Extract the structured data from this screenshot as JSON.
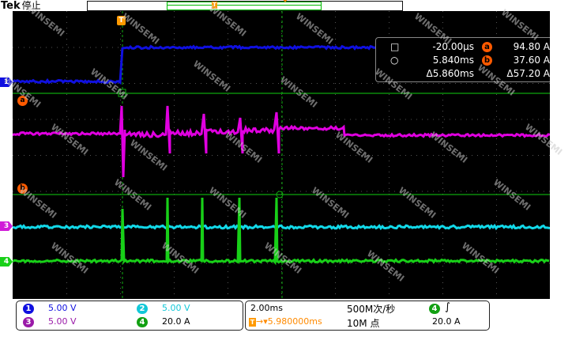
{
  "header": {
    "brand": "Tek",
    "state": "停止",
    "trigger_marker": "T"
  },
  "colors": {
    "ch1": "#1010e0",
    "ch2": "#12d8e8",
    "ch3": "#d01ad8",
    "ch4": "#18d018",
    "ref_a": "#e000e0",
    "ref_b": "#10d010",
    "cursor_orange": "#ff6a00",
    "grid": "#555555"
  },
  "markers": {
    "ch1": "1",
    "ch3": "3",
    "ch4": "4",
    "ref_a": "a",
    "ref_b": "b"
  },
  "measurements": {
    "rows": [
      {
        "symbol": "□",
        "time": "-20.00µs",
        "badge": "a",
        "value": "94.80 A"
      },
      {
        "symbol": "○",
        "time": "5.840ms",
        "badge": "b",
        "value": "37.60 A"
      },
      {
        "symbol": "",
        "time": "Δ5.860ms",
        "badge": "",
        "value": "Δ57.20 A"
      }
    ]
  },
  "channels": [
    {
      "id": "1",
      "scale": "5.00 V"
    },
    {
      "id": "3",
      "scale": "5.00 V"
    },
    {
      "id": "2",
      "scale": "5.00 V"
    },
    {
      "id": "4",
      "scale": "20.0 A"
    }
  ],
  "timebase": {
    "scale": "2.00ms",
    "sample_rate": "500M次/秒",
    "trigger_pos": "5.980000ms",
    "record_length": "10M 点"
  },
  "trigger": {
    "channel": "4",
    "slope": "∫",
    "level": "20.0 A"
  },
  "watermark": "WINSEMI"
}
